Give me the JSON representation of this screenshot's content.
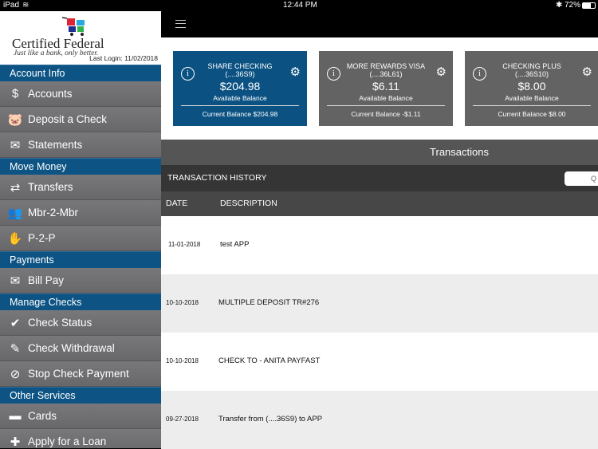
{
  "status": {
    "device": "iPad",
    "time": "12:44 PM",
    "battery": "72%"
  },
  "brand": {
    "name": "Certified Federal",
    "tagline": "Just like a bank, only better.",
    "last_login": "Last Login:  11/02/2018"
  },
  "sidebar": [
    {
      "type": "section",
      "label": "Account Info"
    },
    {
      "type": "item",
      "label": "Accounts",
      "icon": "money-bag-icon",
      "glyph": "$"
    },
    {
      "type": "item",
      "label": "Deposit a Check",
      "icon": "piggy-bank-icon",
      "glyph": "🐷"
    },
    {
      "type": "item",
      "label": "Statements",
      "icon": "envelope-icon",
      "glyph": "✉"
    },
    {
      "type": "section",
      "label": "Move Money"
    },
    {
      "type": "item",
      "label": "Transfers",
      "icon": "transfer-icon",
      "glyph": "⇄"
    },
    {
      "type": "item",
      "label": "Mbr-2-Mbr",
      "icon": "members-icon",
      "glyph": "👥"
    },
    {
      "type": "item",
      "label": "P-2-P",
      "icon": "hand-money-icon",
      "glyph": "✋"
    },
    {
      "type": "section",
      "label": "Payments"
    },
    {
      "type": "item",
      "label": "Bill Pay",
      "icon": "bill-icon",
      "glyph": "✉"
    },
    {
      "type": "section",
      "label": "Manage Checks"
    },
    {
      "type": "item",
      "label": "Check Status",
      "icon": "checkmark-icon",
      "glyph": "✔"
    },
    {
      "type": "item",
      "label": "Check Withdrawal",
      "icon": "check-write-icon",
      "glyph": "✎"
    },
    {
      "type": "item",
      "label": "Stop Check Payment",
      "icon": "stop-icon",
      "glyph": "⊘"
    },
    {
      "type": "section",
      "label": "Other Services"
    },
    {
      "type": "item",
      "label": "Cards",
      "icon": "card-icon",
      "glyph": "▬"
    },
    {
      "type": "item",
      "label": "Apply for a Loan",
      "icon": "plus-icon",
      "glyph": "✚"
    }
  ],
  "cards": [
    {
      "name": "SHARE CHECKING",
      "acct": "(....36S9)",
      "amount": "$204.98",
      "avail": "Available Balance",
      "current": "Current Balance $204.98",
      "color": "#0b5283"
    },
    {
      "name": "MORE REWARDS VISA",
      "acct": "(....36L61)",
      "amount": "$6.11",
      "avail": "Available Balance",
      "current": "Current Balance -$1.11",
      "color": "#636363"
    },
    {
      "name": "CHECKING PLUS",
      "acct": "(....36S10)",
      "amount": "$8.00",
      "avail": "Available Balance",
      "current": "Current Balance $8.00",
      "color": "#636363"
    }
  ],
  "transactions": {
    "title": "Transactions",
    "history": "TRANSACTION HISTORY",
    "search_placeholder": "Q",
    "col_date": "DATE",
    "col_desc": "DESCRIPTION",
    "rows": [
      {
        "date": "11-01-2018",
        "desc": "test APP"
      },
      {
        "date": "10-10-2018",
        "desc": "MULTIPLE DEPOSIT TR#276"
      },
      {
        "date": "10-10-2018",
        "desc": "CHECK TO - ANITA PAYFAST"
      },
      {
        "date": "09-27-2018",
        "desc": "Transfer from (....36S9) to APP"
      }
    ]
  }
}
